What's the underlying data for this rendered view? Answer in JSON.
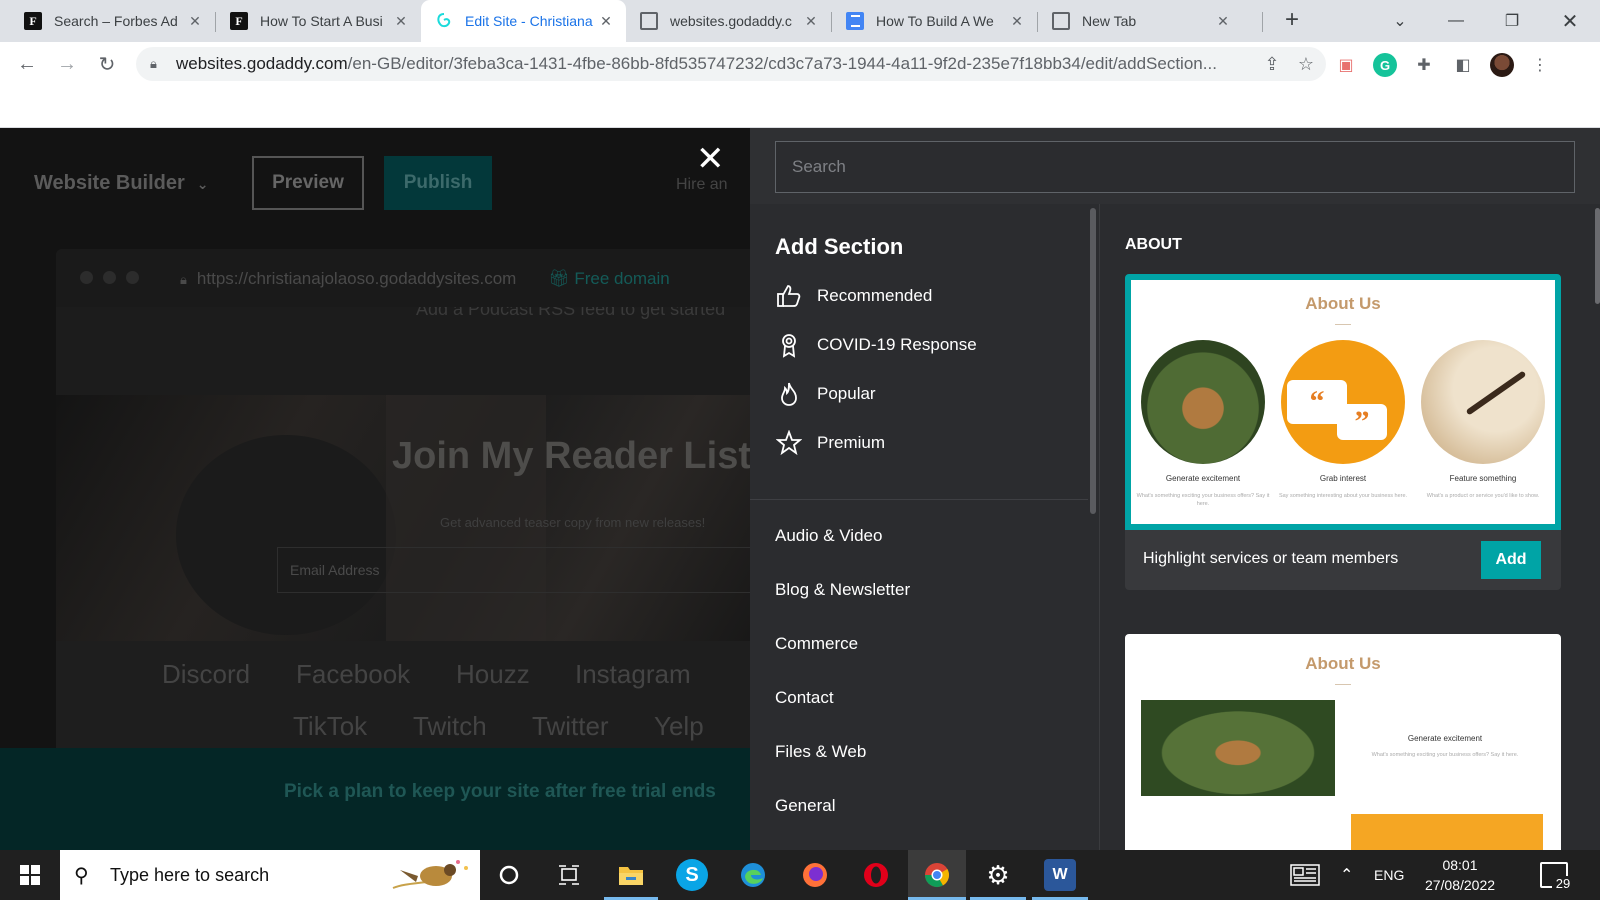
{
  "browser": {
    "tabs": [
      {
        "title": "Search – Forbes Ad",
        "favicon": "forbes-f-icon"
      },
      {
        "title": "How To Start A Busi",
        "favicon": "forbes-f-icon"
      },
      {
        "title": "Edit Site - Christiana",
        "favicon": "godaddy-icon",
        "active": true
      },
      {
        "title": "websites.godaddy.c",
        "favicon": "globe-icon"
      },
      {
        "title": "How To Build A We",
        "favicon": "docs-icon"
      },
      {
        "title": "New Tab",
        "favicon": "globe-icon"
      }
    ],
    "url_host": "websites.godaddy.com",
    "url_path": "/en-GB/editor/3feba3ca-1431-4fbe-86bb-8fd535747232/cd3c7a73-1944-4a11-9f2d-235e7f18bb34/edit/addSection..."
  },
  "editor": {
    "logo": "Website Builder",
    "preview": "Preview",
    "publish": "Publish",
    "hire": "Hire an",
    "site_url": "https://christianajolaoso.godaddysites.com",
    "free_domain": "Free domain",
    "podcast_text": "Add a Podcast RSS feed to get started",
    "hero_title": "Join My Reader List",
    "hero_sub": "Get advanced teaser copy from new releases!",
    "email_placeholder": "Email Address",
    "socials": [
      "Discord",
      "Facebook",
      "Houzz",
      "Instagram",
      "TikTok",
      "Twitch",
      "Twitter",
      "Yelp"
    ],
    "plan_text": "Pick a plan to keep your site after free trial ends"
  },
  "panel": {
    "search_placeholder": "Search",
    "title": "Add Section",
    "featured": [
      {
        "label": "Recommended",
        "icon": "thumbs-up-icon"
      },
      {
        "label": "COVID-19 Response",
        "icon": "ribbon-icon"
      },
      {
        "label": "Popular",
        "icon": "flame-icon"
      },
      {
        "label": "Premium",
        "icon": "star-icon"
      }
    ],
    "categories": [
      "Audio & Video",
      "Blog & Newsletter",
      "Commerce",
      "Contact",
      "Files & Web",
      "General"
    ],
    "section_heading": "ABOUT",
    "card1": {
      "title": "About Us",
      "items": [
        {
          "label": "Generate excitement",
          "desc": "What's something exciting your business offers? Say it here."
        },
        {
          "label": "Grab interest",
          "desc": "Say something interesting about your business here."
        },
        {
          "label": "Feature something",
          "desc": "What's a product or service you'd like to show."
        }
      ],
      "caption": "Highlight services or team members",
      "add": "Add"
    },
    "card2": {
      "title": "About Us",
      "label": "Generate excitement",
      "desc": "What's something exciting your business offers? Say it here."
    }
  },
  "taskbar": {
    "search_placeholder": "Type here to search",
    "lang": "ENG",
    "time": "08:01",
    "date": "27/08/2022",
    "notifications": "29"
  },
  "colors": {
    "accent": "#00a4a6",
    "panel_bg": "#2b2c2f",
    "chrome_active": "#1a73e8"
  }
}
